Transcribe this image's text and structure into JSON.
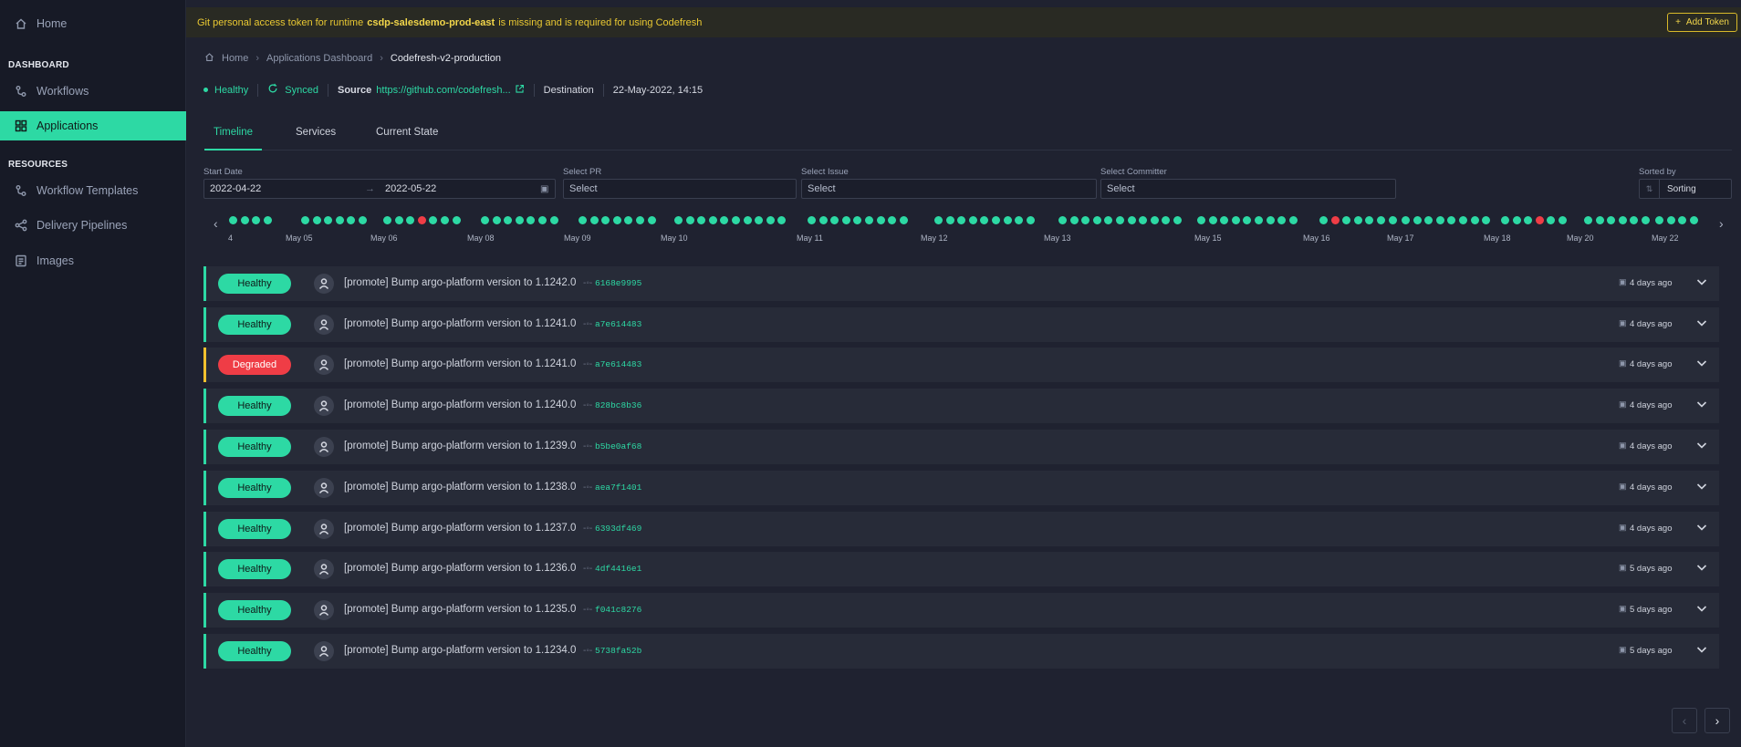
{
  "sidebar": {
    "home": "Home",
    "dashboard_section": "DASHBOARD",
    "workflows": "Workflows",
    "applications": "Applications",
    "resources_section": "RESOURCES",
    "workflow_templates": "Workflow Templates",
    "delivery_pipelines": "Delivery Pipelines",
    "images": "Images"
  },
  "banner": {
    "text_before": "Git personal access token for runtime",
    "runtime": "csdp-salesdemo-prod-east",
    "text_after": "is missing and is required for using Codefresh",
    "add_token": "Add Token"
  },
  "breadcrumb": {
    "home": "Home",
    "dashboard": "Applications Dashboard",
    "current": "Codefresh-v2-production"
  },
  "status": {
    "health": "Healthy",
    "sync": "Synced",
    "source_label": "Source",
    "source_url": "https://github.com/codefresh...",
    "destination_label": "Destination",
    "timestamp": "22-May-2022, 14:15"
  },
  "tabs": [
    "Timeline",
    "Services",
    "Current State"
  ],
  "filters": {
    "start_date_label": "Start Date",
    "start_date": "2022-04-22",
    "end_date": "2022-05-22",
    "pr_label": "Select PR",
    "pr_placeholder": "Select",
    "issue_label": "Select Issue",
    "issue_placeholder": "Select",
    "committer_label": "Select Committer",
    "committer_placeholder": "Select",
    "sorted_label": "Sorted by",
    "sorting": "Sorting"
  },
  "timeline": {
    "dates": [
      "4",
      "May 05",
      "May 06",
      "May 08",
      "May 09",
      "May 10",
      "May 11",
      "May 12",
      "May 13",
      "May 15",
      "May 16",
      "May 17",
      "May 18",
      "May 20",
      "May 22"
    ],
    "colors": {
      "healthy": "#2dd9a4",
      "degraded": "#ef3d46"
    }
  },
  "rows": [
    {
      "status": "Healthy",
      "message": "[promote] Bump argo-platform version to 1.1242.0",
      "sha": "6168e9995",
      "ago": "4 days ago"
    },
    {
      "status": "Healthy",
      "message": "[promote] Bump argo-platform version to 1.1241.0",
      "sha": "a7e614483",
      "ago": "4 days ago"
    },
    {
      "status": "Degraded",
      "message": "[promote] Bump argo-platform version to 1.1241.0",
      "sha": "a7e614483",
      "ago": "4 days ago"
    },
    {
      "status": "Healthy",
      "message": "[promote] Bump argo-platform version to 1.1240.0",
      "sha": "828bc8b36",
      "ago": "4 days ago"
    },
    {
      "status": "Healthy",
      "message": "[promote] Bump argo-platform version to 1.1239.0",
      "sha": "b5be0af68",
      "ago": "4 days ago"
    },
    {
      "status": "Healthy",
      "message": "[promote] Bump argo-platform version to 1.1238.0",
      "sha": "aea7f1401",
      "ago": "4 days ago"
    },
    {
      "status": "Healthy",
      "message": "[promote] Bump argo-platform version to 1.1237.0",
      "sha": "6393df469",
      "ago": "4 days ago"
    },
    {
      "status": "Healthy",
      "message": "[promote] Bump argo-platform version to 1.1236.0",
      "sha": "4df4416e1",
      "ago": "5 days ago"
    },
    {
      "status": "Healthy",
      "message": "[promote] Bump argo-platform version to 1.1235.0",
      "sha": "f041c8276",
      "ago": "5 days ago"
    },
    {
      "status": "Healthy",
      "message": "[promote] Bump argo-platform version to 1.1234.0",
      "sha": "5738fa52b",
      "ago": "5 days ago"
    }
  ],
  "icons": {
    "pager_prev": "chevron-left-icon",
    "pager_next": "chevron-right-icon"
  }
}
